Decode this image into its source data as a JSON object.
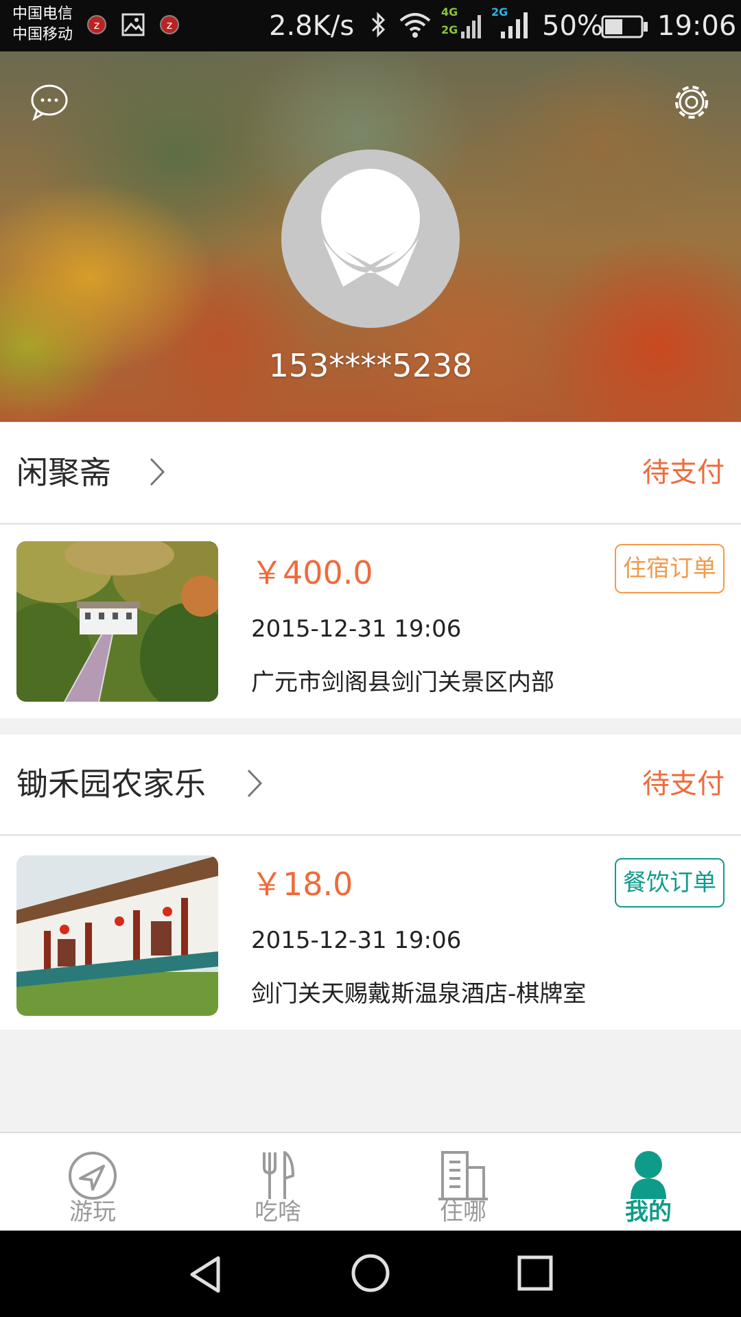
{
  "status_bar": {
    "carrier_1": "中国电信",
    "carrier_2": "中国移动",
    "net_speed": "2.8K/s",
    "net_4g": "4G",
    "net_2g_a": "2G",
    "net_2g_b": "2G",
    "battery": "50%",
    "battery_level": 0.5,
    "time": "19:06",
    "icons": [
      "alarm-icon",
      "image-icon",
      "alarm-icon",
      "bluetooth-icon",
      "wifi-icon",
      "signal-icon",
      "signal-icon",
      "battery-icon"
    ]
  },
  "header": {
    "left_icon": "message-icon",
    "right_icon": "settings-icon",
    "username": "153****5238"
  },
  "orders": [
    {
      "shop": "闲聚斋",
      "status": "待支付",
      "price": "￥400.0",
      "date": "2015-12-31 19:06",
      "address": "广元市剑阁县剑门关景区内部",
      "tag": "住宿订单",
      "tag_color": "#f29a4a"
    },
    {
      "shop": "锄禾园农家乐",
      "status": "待支付",
      "price": "￥18.0",
      "date": "2015-12-31 19:06",
      "address": "剑门关天赐戴斯温泉酒店-棋牌室",
      "tag": "餐饮订单",
      "tag_color": "#0f9b8a"
    }
  ],
  "tabs": [
    {
      "label": "游玩",
      "icon": "compass-icon"
    },
    {
      "label": "吃啥",
      "icon": "fork-knife-icon"
    },
    {
      "label": "住哪",
      "icon": "building-icon"
    },
    {
      "label": "我的",
      "icon": "user-icon",
      "active": true
    }
  ],
  "colors": {
    "accent": "#0f9b8a",
    "price": "#f06a3a",
    "inactive": "#9a9a9a"
  }
}
